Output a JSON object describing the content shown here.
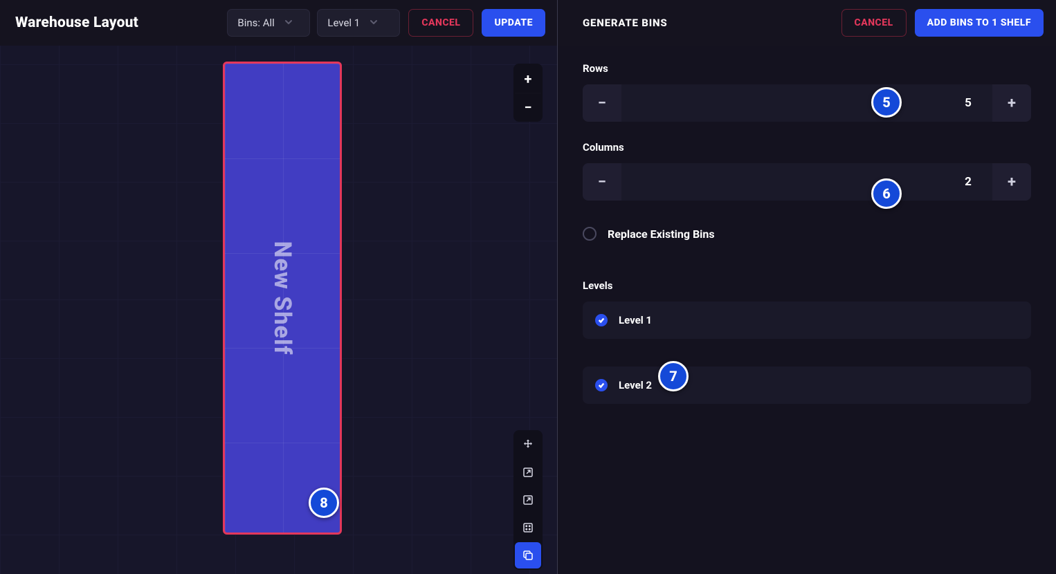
{
  "left": {
    "title": "Warehouse Layout",
    "bins_select": "Bins: All",
    "level_select": "Level 1",
    "cancel_label": "CANCEL",
    "update_label": "UPDATE",
    "shelf_label": "New Shelf"
  },
  "right": {
    "panel_title": "GENERATE BINS",
    "cancel_label": "CANCEL",
    "add_label": "ADD BINS TO 1 SHELF",
    "rows_label": "Rows",
    "rows_value": "5",
    "columns_label": "Columns",
    "columns_value": "2",
    "replace_label": "Replace Existing Bins",
    "levels_label": "Levels",
    "level1_label": "Level 1",
    "level2_label": "Level 2"
  },
  "markers": {
    "m5": "5",
    "m6": "6",
    "m7": "7",
    "m8": "8"
  }
}
